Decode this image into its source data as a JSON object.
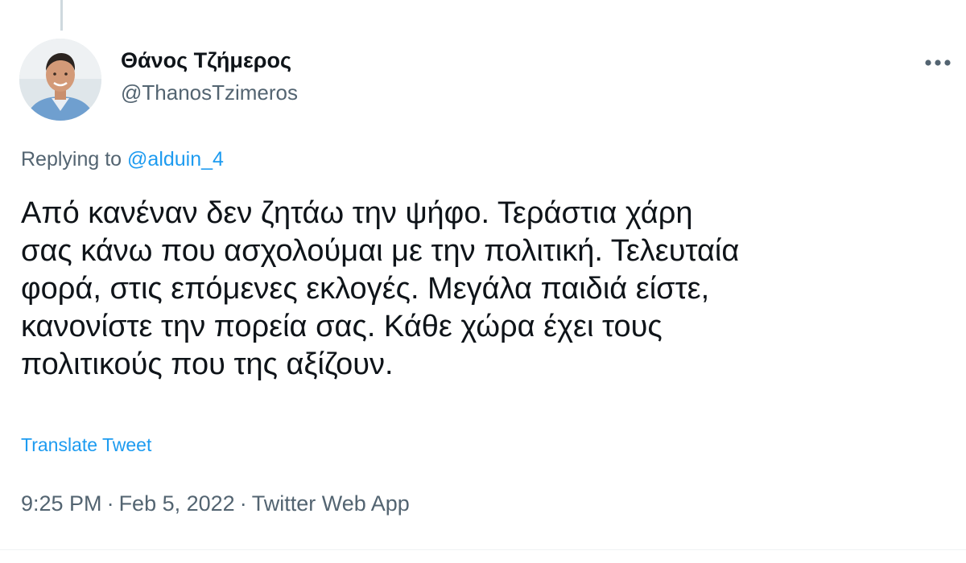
{
  "author": {
    "display_name": "Θάνος Τζήμερος",
    "handle": "@ThanosTzimeros",
    "avatar_icon": "profile-photo"
  },
  "menu": {
    "icon": "more-horizontal-icon"
  },
  "reply": {
    "prefix": "Replying to ",
    "mention": "@alduin_4"
  },
  "text": {
    "lines": [
      "Από κανέναν δεν ζητάω την ψήφο. Τεράστια χάρη",
      "σας κάνω που ασχολούμαι με την πολιτική. Τελευταία",
      "φορά, στις επόμενες εκλογές. Μεγάλα παιδιά είστε,",
      "κανονίστε την πορεία σας. Κάθε χώρα έχει τους",
      "πολιτικούς που της αξίζουν."
    ]
  },
  "translate_label": "Translate Tweet",
  "meta": {
    "time": "9:25 PM",
    "separator": "·",
    "date": "Feb 5, 2022",
    "source": "Twitter Web App"
  },
  "colors": {
    "accent": "#1d9bf0",
    "secondary_text": "#536471",
    "primary_text": "#0f1419"
  }
}
